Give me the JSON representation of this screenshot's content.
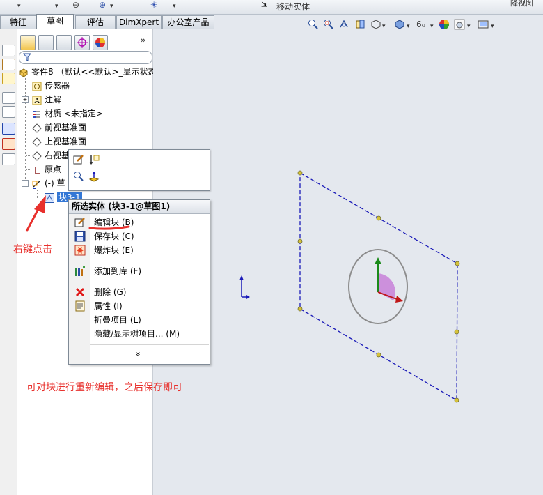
{
  "toolbar": {
    "move_entity_label": "移动实体",
    "right_label": "降视图"
  },
  "tabs": [
    {
      "label": "特征"
    },
    {
      "label": "草图"
    },
    {
      "label": "评估"
    },
    {
      "label": "DimXpert"
    },
    {
      "label": "办公室产品"
    }
  ],
  "tree": {
    "root": "零件8 （默认<<默认>_显示状态",
    "items": [
      {
        "label": "传感器",
        "icon": "sensor-icon"
      },
      {
        "label": "注解",
        "icon": "annotation-icon"
      },
      {
        "label": "材质 <未指定>",
        "icon": "material-icon"
      },
      {
        "label": "前视基准面",
        "icon": "plane-icon"
      },
      {
        "label": "上视基准面",
        "icon": "plane-icon"
      },
      {
        "label": "右视基",
        "icon": "plane-icon"
      },
      {
        "label": "原点",
        "icon": "origin-icon"
      },
      {
        "label": "(-) 草",
        "icon": "sketch-icon"
      }
    ],
    "selected_block": "块3-1"
  },
  "context_menu": {
    "header": "所选实体 (块3-1@草图1)",
    "items": [
      {
        "label": "编辑块 (B)",
        "icon": "edit-block-icon"
      },
      {
        "label": "保存块 (C)",
        "icon": "save-block-icon"
      },
      {
        "label": "爆炸块 (E)",
        "icon": "explode-block-icon"
      },
      {
        "label": "添加到库 (F)",
        "icon": "add-to-library-icon"
      },
      {
        "label": "删除 (G)",
        "icon": "delete-icon"
      },
      {
        "label": "属性 (I)",
        "icon": "properties-icon"
      },
      {
        "label": "折叠项目 (L)",
        "icon": ""
      },
      {
        "label": "隐藏/显示树项目... (M)",
        "icon": ""
      }
    ],
    "more": "»"
  },
  "annotations": {
    "right_click": "右键点击",
    "note": "可对块进行重新编辑，之后保存即可"
  },
  "colors": {
    "annotation_red": "#e8302c",
    "sketch_blue": "#1a1ab8",
    "viewport_bg": "#e4e8ee"
  }
}
